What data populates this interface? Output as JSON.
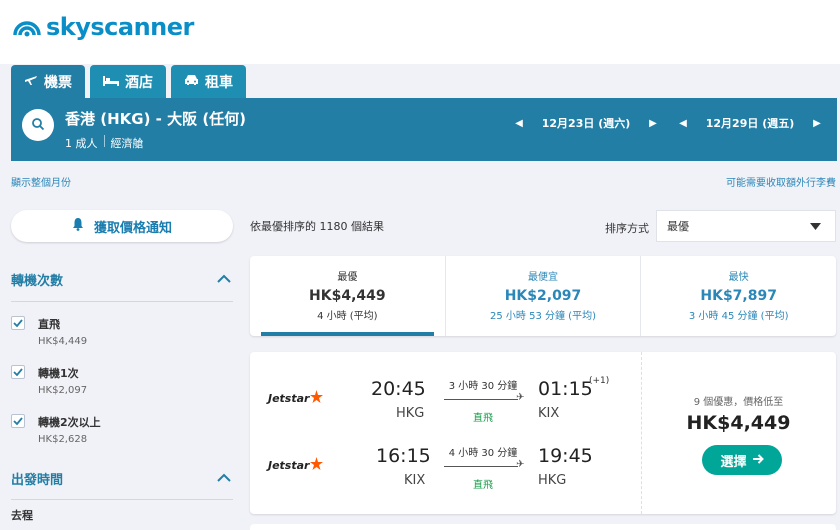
{
  "brand": {
    "name": "skyscanner",
    "color": "#0a8ec8"
  },
  "tabs": [
    {
      "label": "機票",
      "icon": "plane-icon"
    },
    {
      "label": "酒店",
      "icon": "bed-icon"
    },
    {
      "label": "租車",
      "icon": "car-icon"
    }
  ],
  "search": {
    "route": "香港 (HKG) - 大阪 (任何)",
    "passengers": "1 成人",
    "cabin": "經濟艙",
    "depart_date": "12月23日 (週六)",
    "return_date": "12月29日 (週五)"
  },
  "links": {
    "whole_month": "顯示整個月份",
    "baggage_fee": "可能需要收取額外行李費"
  },
  "filters": {
    "alert_button": "獲取價格通知",
    "stops_title": "轉機次數",
    "stops": [
      {
        "label": "直飛",
        "price": "HK$4,449",
        "checked": true
      },
      {
        "label": "轉機1次",
        "price": "HK$2,097",
        "checked": true
      },
      {
        "label": "轉機2次以上",
        "price": "HK$2,628",
        "checked": true
      }
    ],
    "departure_title": "出發時間",
    "outbound_label": "去程"
  },
  "results": {
    "count_text": "依最優排序的 1180 個結果",
    "sort_label": "排序方式",
    "sort_value": "最優"
  },
  "sort_options": [
    {
      "label": "最優",
      "price": "HK$4,449",
      "duration": "4 小時 (平均)",
      "selected": true
    },
    {
      "label": "最便宜",
      "price": "HK$2,097",
      "duration": "25 小時 53 分鐘 (平均)",
      "selected": false
    },
    {
      "label": "最快",
      "price": "HK$7,897",
      "duration": "3 小時 45 分鐘 (平均)",
      "selected": false
    }
  ],
  "flight": {
    "outbound": {
      "airline": "Jetstar",
      "depart_time": "20:45",
      "depart_airport": "HKG",
      "duration": "3 小時 30 分鐘",
      "stops": "直飛",
      "arrive_time": "01:15",
      "arrive_offset": "(+1)",
      "arrive_airport": "KIX"
    },
    "inbound": {
      "airline": "Jetstar",
      "depart_time": "16:15",
      "depart_airport": "KIX",
      "duration": "4 小時 30 分鐘",
      "stops": "直飛",
      "arrive_time": "19:45",
      "arrive_airport": "HKG"
    },
    "deals_text": "9 個優惠，價格低至",
    "price": "HK$4,449",
    "select_label": "選擇"
  }
}
